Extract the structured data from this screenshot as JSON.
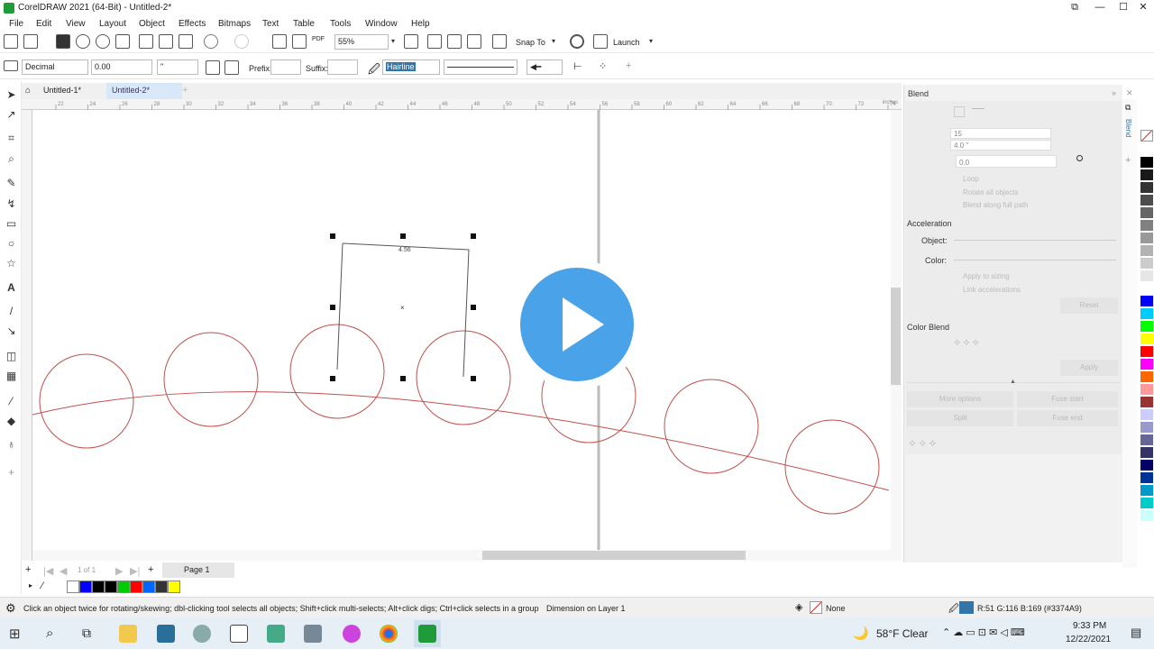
{
  "window": {
    "title": "CorelDRAW 2021 (64-Bit) - Untitled-2*"
  },
  "menu": [
    "File",
    "Edit",
    "View",
    "Layout",
    "Object",
    "Effects",
    "Bitmaps",
    "Text",
    "Table",
    "Tools",
    "Window",
    "Help"
  ],
  "toolbar": {
    "zoom": "55%",
    "snap": "Snap To",
    "launch": "Launch",
    "pdf": "PDF"
  },
  "propbar": {
    "units": "Decimal",
    "value": "0.00",
    "unit_symbol": "\"",
    "prefix_label": "Prefix:",
    "suffix_label": "Suffix:",
    "outline": "Hairline"
  },
  "tabs": [
    "Untitled-1*",
    "Untitled-2*"
  ],
  "ruler": {
    "unit": "inches",
    "ticks": [
      "22",
      "24",
      "26",
      "28",
      "30",
      "32",
      "34",
      "36",
      "38",
      "40",
      "42",
      "44",
      "46",
      "48",
      "50",
      "52",
      "54",
      "56",
      "58",
      "60",
      "62",
      "64",
      "66",
      "68",
      "70",
      "72",
      "74"
    ]
  },
  "canvas": {
    "dimension_label": "4.56"
  },
  "pager": {
    "counter": "1 of 1",
    "page": "Page 1"
  },
  "docker": {
    "title": "Blend",
    "steps": "15",
    "spacing": "4.0 \"",
    "angle": "0.0",
    "acceleration": "Acceleration",
    "object": "Object:",
    "color": "Color:",
    "color_blend": "Color Blend",
    "loop": "Loop",
    "rotate": "Rotate all objects",
    "blend_along": "Blend along full path",
    "link_acc": "Link accelerations",
    "apply_sizing": "Apply to sizing",
    "reset": "Reset",
    "apply": "Apply",
    "more_options": "More options",
    "fuse_start": "Fuse start",
    "split": "Split",
    "fuse_end": "Fuse end",
    "side_tab": "Blend"
  },
  "status": {
    "hint": "Click an object twice for rotating/skewing; dbl-clicking tool selects all objects; Shift+click multi-selects; Alt+click digs; Ctrl+click selects in a group",
    "layer": "Dimension on Layer 1",
    "fill": "None",
    "color_values": "R:51 G:116 B:169 (#3374A9)"
  },
  "taskbar": {
    "weather": "58°F  Clear",
    "time": "9:33 PM",
    "date": "12/22/2021"
  },
  "colors": {
    "accent": "#3374A9",
    "play": "#4aa3e8",
    "curve": "#c0504d"
  },
  "swatches": [
    "#ffffff",
    "#0000ff",
    "#000000",
    "#000000",
    "#00cc00",
    "#ff0000",
    "#0066ff",
    "#333333",
    "#ffff00"
  ],
  "palette": [
    "#ffffff",
    "#000000",
    "#1a1a1a",
    "#333333",
    "#4d4d4d",
    "#666666",
    "#808080",
    "#999999",
    "#b3b3b3",
    "#cccccc",
    "#e6e6e6",
    "#ffffff",
    "#0000ff",
    "#00ccff",
    "#00ff00",
    "#ffff00",
    "#ff0000",
    "#ff00ff",
    "#ff6600",
    "#ff9999",
    "#993333",
    "#ccccff",
    "#9999cc",
    "#666699",
    "#333366",
    "#000066",
    "#003399",
    "#0099cc",
    "#00cccc",
    "#ccffff"
  ]
}
